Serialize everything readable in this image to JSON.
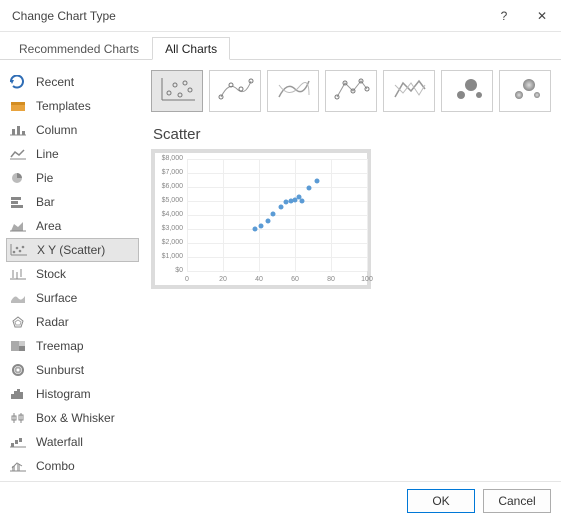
{
  "title": "Change Chart Type",
  "help_glyph": "?",
  "close_glyph": "✕",
  "tabs": {
    "recommended": "Recommended Charts",
    "all": "All Charts"
  },
  "side": {
    "items": [
      {
        "label": "Recent",
        "icon": "recent-icon"
      },
      {
        "label": "Templates",
        "icon": "templates-icon"
      },
      {
        "label": "Column",
        "icon": "column-icon"
      },
      {
        "label": "Line",
        "icon": "line-icon"
      },
      {
        "label": "Pie",
        "icon": "pie-icon"
      },
      {
        "label": "Bar",
        "icon": "bar-icon"
      },
      {
        "label": "Area",
        "icon": "area-icon"
      },
      {
        "label": "X Y (Scatter)",
        "icon": "scatter-icon"
      },
      {
        "label": "Stock",
        "icon": "stock-icon"
      },
      {
        "label": "Surface",
        "icon": "surface-icon"
      },
      {
        "label": "Radar",
        "icon": "radar-icon"
      },
      {
        "label": "Treemap",
        "icon": "treemap-icon"
      },
      {
        "label": "Sunburst",
        "icon": "sunburst-icon"
      },
      {
        "label": "Histogram",
        "icon": "histogram-icon"
      },
      {
        "label": "Box & Whisker",
        "icon": "box-whisker-icon"
      },
      {
        "label": "Waterfall",
        "icon": "waterfall-icon"
      },
      {
        "label": "Combo",
        "icon": "combo-icon"
      }
    ],
    "selected_index": 7
  },
  "subtypes": {
    "names": [
      "scatter",
      "scatter-smooth-markers",
      "scatter-smooth",
      "scatter-lines-markers",
      "scatter-lines",
      "bubble",
      "bubble-3d"
    ],
    "selected_index": 0
  },
  "section_title": "Scatter",
  "footer": {
    "ok": "OK",
    "cancel": "Cancel"
  },
  "chart_data": {
    "type": "scatter",
    "points": [
      {
        "x": 38,
        "y": 3000
      },
      {
        "x": 41,
        "y": 3200
      },
      {
        "x": 45,
        "y": 3600
      },
      {
        "x": 48,
        "y": 4100
      },
      {
        "x": 52,
        "y": 4600
      },
      {
        "x": 55,
        "y": 4900
      },
      {
        "x": 58,
        "y": 5000
      },
      {
        "x": 60,
        "y": 5100
      },
      {
        "x": 62,
        "y": 5300
      },
      {
        "x": 64,
        "y": 5000
      },
      {
        "x": 68,
        "y": 5900
      },
      {
        "x": 72,
        "y": 6400
      }
    ],
    "xlim": [
      0,
      100
    ],
    "ylim": [
      0,
      8000
    ],
    "xticks": [
      0,
      20,
      40,
      60,
      80,
      100
    ],
    "yticks": [
      0,
      1000,
      2000,
      3000,
      4000,
      5000,
      6000,
      7000,
      8000
    ],
    "ytick_labels": [
      "$0",
      "$1,000",
      "$2,000",
      "$3,000",
      "$4,000",
      "$5,000",
      "$6,000",
      "$7,000",
      "$8,000"
    ],
    "title": "",
    "xlabel": "",
    "ylabel": ""
  }
}
